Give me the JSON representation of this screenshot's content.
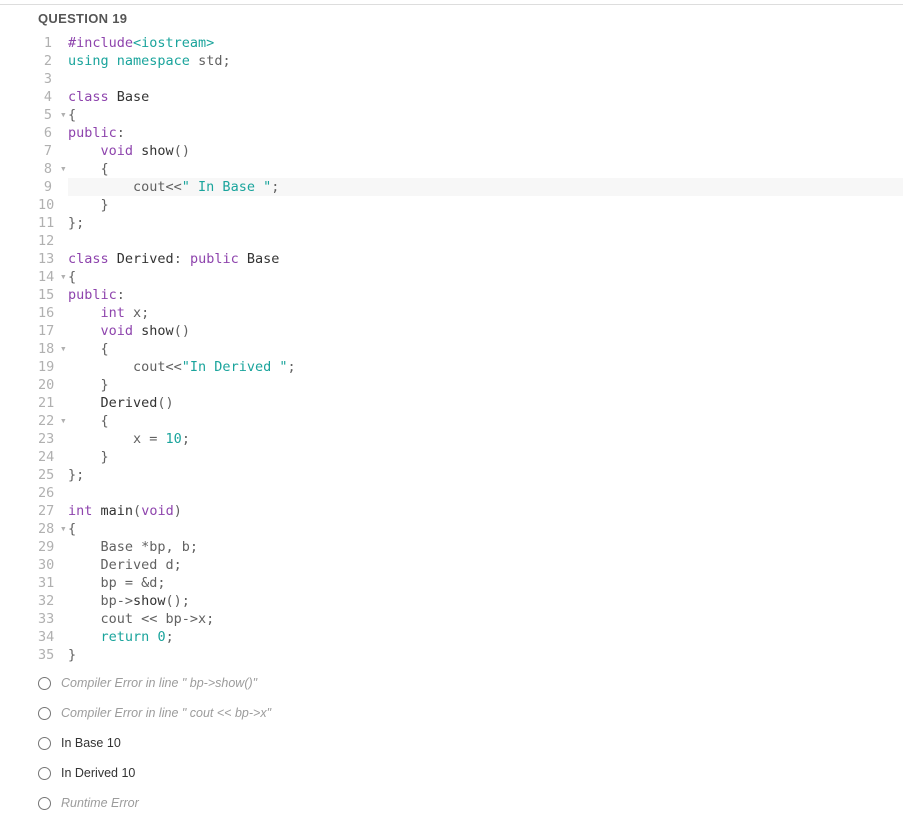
{
  "question": {
    "title": "QUESTION 19"
  },
  "code": [
    {
      "n": "1",
      "f": "",
      "hl": false,
      "html": "<span class='kw-pre'>#include</span><span class='str'>&lt;iostream&gt;</span>"
    },
    {
      "n": "2",
      "f": "",
      "hl": false,
      "html": "<span class='kw-using'>using</span> <span class='kw-ns'>namespace</span> std;"
    },
    {
      "n": "3",
      "f": "",
      "hl": false,
      "html": ""
    },
    {
      "n": "4",
      "f": "",
      "hl": false,
      "html": "<span class='kw-class'>class</span> <span class='fn'>Base</span>"
    },
    {
      "n": "5",
      "f": "▾",
      "hl": false,
      "html": "{"
    },
    {
      "n": "6",
      "f": "",
      "hl": false,
      "html": "<span class='kw-access'>public</span>:"
    },
    {
      "n": "7",
      "f": "",
      "hl": false,
      "html": "    <span class='kw-type'>void</span> <span class='fn'>show</span>()"
    },
    {
      "n": "8",
      "f": "▾",
      "hl": false,
      "html": "    {"
    },
    {
      "n": "9",
      "f": "",
      "hl": true,
      "html": "        cout&lt;&lt;<span class='str'>\" In Base \"</span>;"
    },
    {
      "n": "10",
      "f": "",
      "hl": false,
      "html": "    }"
    },
    {
      "n": "11",
      "f": "",
      "hl": false,
      "html": "};"
    },
    {
      "n": "12",
      "f": "",
      "hl": false,
      "html": ""
    },
    {
      "n": "13",
      "f": "",
      "hl": false,
      "html": "<span class='kw-class'>class</span> <span class='fn'>Derived</span>: <span class='kw-access'>public</span> <span class='fn'>Base</span>"
    },
    {
      "n": "14",
      "f": "▾",
      "hl": false,
      "html": "{"
    },
    {
      "n": "15",
      "f": "",
      "hl": false,
      "html": "<span class='kw-access'>public</span>:"
    },
    {
      "n": "16",
      "f": "",
      "hl": false,
      "html": "    <span class='kw-type'>int</span> x;"
    },
    {
      "n": "17",
      "f": "",
      "hl": false,
      "html": "    <span class='kw-type'>void</span> <span class='fn'>show</span>()"
    },
    {
      "n": "18",
      "f": "▾",
      "hl": false,
      "html": "    {"
    },
    {
      "n": "19",
      "f": "",
      "hl": false,
      "html": "        cout&lt;&lt;<span class='str'>\"In Derived \"</span>;"
    },
    {
      "n": "20",
      "f": "",
      "hl": false,
      "html": "    }"
    },
    {
      "n": "21",
      "f": "",
      "hl": false,
      "html": "    <span class='fn'>Derived</span>()"
    },
    {
      "n": "22",
      "f": "▾",
      "hl": false,
      "html": "    {"
    },
    {
      "n": "23",
      "f": "",
      "hl": false,
      "html": "        x = <span class='num'>10</span>;"
    },
    {
      "n": "24",
      "f": "",
      "hl": false,
      "html": "    }"
    },
    {
      "n": "25",
      "f": "",
      "hl": false,
      "html": "};"
    },
    {
      "n": "26",
      "f": "",
      "hl": false,
      "html": ""
    },
    {
      "n": "27",
      "f": "",
      "hl": false,
      "html": "<span class='kw-type'>int</span> <span class='fn'>main</span>(<span class='kw-type'>void</span>)"
    },
    {
      "n": "28",
      "f": "▾",
      "hl": false,
      "html": "{"
    },
    {
      "n": "29",
      "f": "",
      "hl": false,
      "html": "    Base *bp, b;"
    },
    {
      "n": "30",
      "f": "",
      "hl": false,
      "html": "    Derived d;"
    },
    {
      "n": "31",
      "f": "",
      "hl": false,
      "html": "    bp = &amp;d;"
    },
    {
      "n": "32",
      "f": "",
      "hl": false,
      "html": "    bp-&gt;<span class='fn'>show</span>();"
    },
    {
      "n": "33",
      "f": "",
      "hl": false,
      "html": "    cout &lt;&lt; bp-&gt;x;"
    },
    {
      "n": "34",
      "f": "",
      "hl": false,
      "html": "    <span class='kw-ctrl'>return</span> <span class='num'>0</span>;"
    },
    {
      "n": "35",
      "f": "",
      "hl": false,
      "html": "}"
    }
  ],
  "options": [
    {
      "label": "Compiler Error in line \" bp->show()\"",
      "disabled": true
    },
    {
      "label": "Compiler Error in line \" cout << bp->x\"",
      "disabled": true
    },
    {
      "label": "In Base 10",
      "disabled": false
    },
    {
      "label": "In Derived 10",
      "disabled": false
    },
    {
      "label": "Runtime Error",
      "disabled": true
    }
  ]
}
